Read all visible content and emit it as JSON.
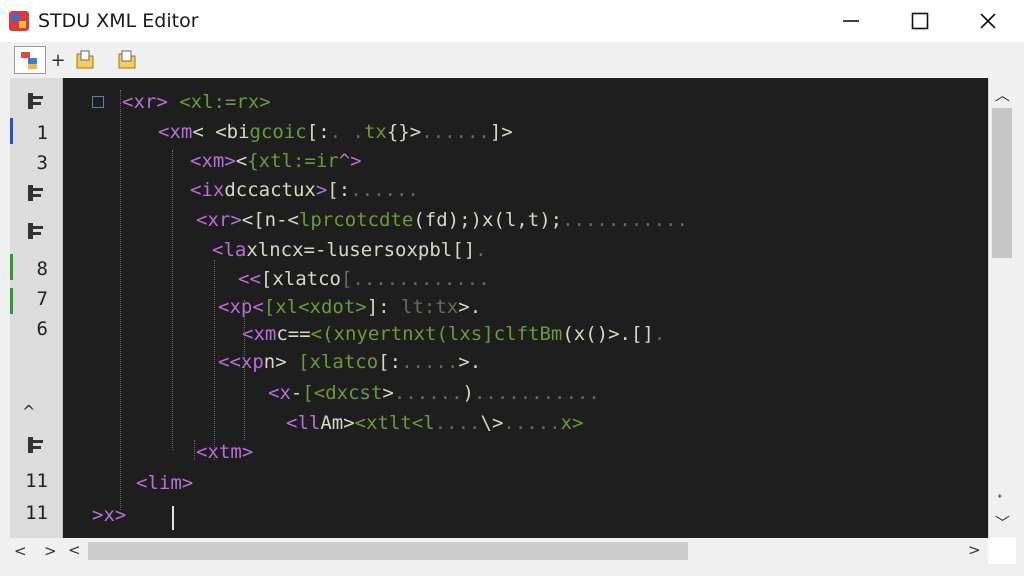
{
  "window": {
    "title": "STDU XML Editor",
    "minimize_glyph": "—",
    "maximize_glyph": "☐",
    "close_glyph": "✕"
  },
  "toolbar": {
    "plus_glyph": "+"
  },
  "gutter": {
    "lines": [
      {
        "kind": "icon",
        "icon": "collapse-icon"
      },
      {
        "kind": "text",
        "text": "1"
      },
      {
        "kind": "text",
        "text": "3"
      },
      {
        "kind": "icon",
        "icon": "collapse-icon"
      },
      {
        "kind": "icon",
        "icon": "expand-icon"
      },
      {
        "kind": "text",
        "text": "8"
      },
      {
        "kind": "text",
        "text": "7"
      },
      {
        "kind": "text",
        "text": "6"
      },
      {
        "kind": "empty"
      },
      {
        "kind": "empty"
      },
      {
        "kind": "icon",
        "icon": "fold-icon"
      },
      {
        "kind": "text",
        "text": "11"
      },
      {
        "kind": "text",
        "text": "11"
      }
    ],
    "up_glyph": "^"
  },
  "code": {
    "lines": [
      [
        {
          "c": "tg",
          "t": "<xr>"
        },
        {
          "c": "gr",
          "t": " <xl:=rx>"
        }
      ],
      [
        {
          "c": "tg",
          "t": "<xm"
        },
        {
          "c": "lt",
          "t": "<"
        },
        {
          "c": "lt",
          "t": " <bi"
        },
        {
          "c": "gr",
          "t": "gcoic"
        },
        {
          "c": "lt",
          "t": "[:"
        },
        {
          "c": "dim",
          "t": ". ."
        },
        {
          "c": "gr",
          "t": "tx"
        },
        {
          "c": "lt",
          "t": "{}>"
        },
        {
          "c": "dim",
          "t": "......"
        },
        {
          "c": "lt",
          "t": "]>"
        }
      ],
      [
        {
          "c": "tg",
          "t": "<xm>"
        },
        {
          "c": "lt",
          "t": "<"
        },
        {
          "c": "gr",
          "t": "{xtl:=ir"
        },
        {
          "c": "tg",
          "t": "^>"
        }
      ],
      [
        {
          "c": "tg",
          "t": "<ix"
        },
        {
          "c": "lt",
          "t": "dccactux"
        },
        {
          "c": "tg",
          "t": ">"
        },
        {
          "c": "lt",
          "t": "[:"
        },
        {
          "c": "dim",
          "t": "......"
        }
      ],
      [
        {
          "c": "tg",
          "t": "<xr>"
        },
        {
          "c": "lt",
          "t": "<[n-<"
        },
        {
          "c": "gr",
          "t": "lprcotcdte"
        },
        {
          "c": "lt",
          "t": "(fd);)x(l,t);"
        },
        {
          "c": "dim",
          "t": "..........."
        }
      ],
      [
        {
          "c": "tg",
          "t": "<la"
        },
        {
          "c": "lt",
          "t": "xlncx=-"
        },
        {
          "c": "lt",
          "t": "lusersoxpbl"
        },
        {
          "c": "lt",
          "t": "[]"
        },
        {
          "c": "dim",
          "t": "."
        }
      ],
      [
        {
          "c": "tg",
          "t": "<<"
        },
        {
          "c": "lt",
          "t": "[xlatco"
        },
        {
          "c": "dim",
          "t": "[............"
        }
      ],
      [
        {
          "c": "tg",
          "t": "<xp<"
        },
        {
          "c": "gr",
          "t": "[xl<xdot>"
        },
        {
          "c": "lt",
          "t": "]:"
        },
        {
          "c": "dim",
          "t": " lt:tx"
        },
        {
          "c": "lt",
          "t": ">."
        }
      ],
      [
        {
          "c": "tg",
          "t": "<xm"
        },
        {
          "c": "lt",
          "t": "c=="
        },
        {
          "c": "gr",
          "t": "<(xnyertnxt(lxs]"
        },
        {
          "c": "gr",
          "t": "clftBm"
        },
        {
          "c": "lt",
          "t": "(x()>."
        },
        {
          "c": "lt",
          "t": "[]"
        },
        {
          "c": "dim",
          "t": "."
        }
      ],
      [
        {
          "c": "tg",
          "t": "<<xp"
        },
        {
          "c": "lt",
          "t": "n>"
        },
        {
          "c": "gr",
          "t": " [xlatco"
        },
        {
          "c": "lt",
          "t": "[:"
        },
        {
          "c": "dim",
          "t": "....."
        },
        {
          "c": "lt",
          "t": ">."
        }
      ],
      [
        {
          "c": "tg",
          "t": "<x"
        },
        {
          "c": "lt",
          "t": "-"
        },
        {
          "c": "gr",
          "t": "[<dxcst"
        },
        {
          "c": "lt",
          "t": ">"
        },
        {
          "c": "dim",
          "t": "......"
        },
        {
          "c": "lt",
          "t": ")"
        },
        {
          "c": "dim",
          "t": "..........."
        }
      ],
      [
        {
          "c": "tg",
          "t": "<ll"
        },
        {
          "c": "lt",
          "t": "Am>"
        },
        {
          "c": "gr",
          "t": "<xtlt<l"
        },
        {
          "c": "dim",
          "t": "...."
        },
        {
          "c": "lt",
          "t": "\\>"
        },
        {
          "c": "dim",
          "t": "....."
        },
        {
          "c": "gr",
          "t": "x>"
        }
      ],
      [
        {
          "c": "tg",
          "t": "<xtm>"
        }
      ],
      [
        {
          "c": "tg",
          "t": "<lim>"
        }
      ],
      [
        {
          "c": "tg",
          "t": ">x>"
        }
      ]
    ]
  },
  "scroll": {
    "up_glyph": "︿",
    "down_glyph": "﹀",
    "left_glyph": "<",
    "right_glyph": ">",
    "g_left_glyph": "<",
    "g_right_glyph": ">"
  }
}
